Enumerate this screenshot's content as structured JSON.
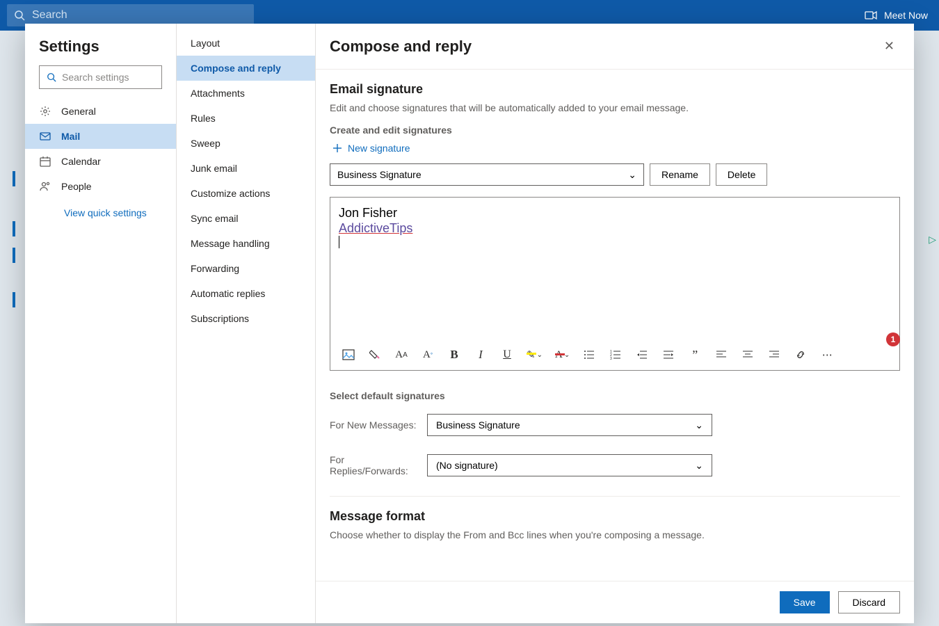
{
  "topbar": {
    "search_placeholder": "Search",
    "meet_now": "Meet Now"
  },
  "settings": {
    "title": "Settings",
    "search_placeholder": "Search settings",
    "nav1": [
      {
        "label": "General",
        "icon": "gear"
      },
      {
        "label": "Mail",
        "icon": "mail",
        "active": true
      },
      {
        "label": "Calendar",
        "icon": "calendar"
      },
      {
        "label": "People",
        "icon": "people"
      }
    ],
    "quick_link": "View quick settings",
    "nav2": [
      "Layout",
      "Compose and reply",
      "Attachments",
      "Rules",
      "Sweep",
      "Junk email",
      "Customize actions",
      "Sync email",
      "Message handling",
      "Forwarding",
      "Automatic replies",
      "Subscriptions"
    ],
    "nav2_active_index": 1
  },
  "panel": {
    "title": "Compose and reply",
    "section_title": "Email signature",
    "section_desc": "Edit and choose signatures that will be automatically added to your email message.",
    "create_edit_label": "Create and edit signatures",
    "new_signature": "New signature",
    "signature_select_value": "Business Signature",
    "rename": "Rename",
    "delete": "Delete",
    "editor_line1": "Jon Fisher",
    "editor_line2": "AddictiveTips",
    "select_default_label": "Select default signatures",
    "for_new_label": "For New Messages:",
    "for_new_value": "Business Signature",
    "for_replies_label": "For Replies/Forwards:",
    "for_replies_value": "(No signature)",
    "message_format_title": "Message format",
    "message_format_desc": "Choose whether to display the From and Bcc lines when you're composing a message.",
    "badge_count": "1",
    "save": "Save",
    "discard": "Discard"
  }
}
